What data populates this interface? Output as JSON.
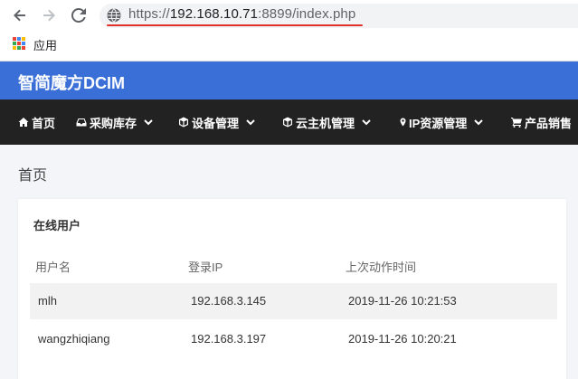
{
  "browser": {
    "url_scheme": "https://",
    "url_host": "192.168.10.71",
    "url_rest": ":8899/index.php",
    "bookmark_apps_label": "应用"
  },
  "colors": {
    "header_blue": "#3a6fd8",
    "nav_dark": "#222222",
    "url_underline": "#e0302a"
  },
  "app": {
    "title": "智简魔方DCIM"
  },
  "nav": {
    "items": [
      {
        "label": "首页",
        "icon": "home-icon"
      },
      {
        "label": "采购库存",
        "icon": "inbox-icon"
      },
      {
        "label": "设备管理",
        "icon": "cube-icon"
      },
      {
        "label": "云主机管理",
        "icon": "cube-icon"
      },
      {
        "label": "IP资源管理",
        "icon": "map-marker-icon"
      },
      {
        "label": "产品销售",
        "icon": "cart-icon"
      }
    ]
  },
  "page": {
    "title": "首页"
  },
  "online_users": {
    "title": "在线用户",
    "columns": [
      "用户名",
      "登录IP",
      "上次动作时间"
    ],
    "rows": [
      [
        "mlh",
        "192.168.3.145",
        "2019-11-26 10:21:53"
      ],
      [
        "wangzhiqiang",
        "192.168.3.197",
        "2019-11-26 10:20:21"
      ]
    ]
  }
}
